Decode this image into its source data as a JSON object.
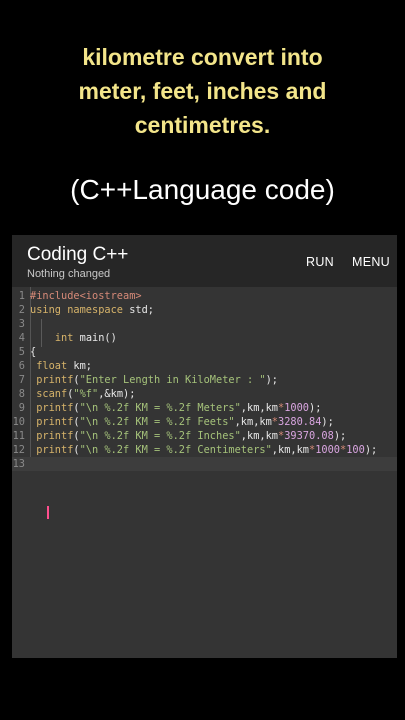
{
  "headline": {
    "lines": [
      "kilometre convert  into",
      "meter, feet, inches and",
      "centimetres."
    ]
  },
  "subheading": "(C++Language code)",
  "app": {
    "title": "Coding C++",
    "status": "Nothing changed",
    "run_label": "RUN",
    "menu_label": "MENU"
  },
  "editor": {
    "active_line": 13,
    "lines": [
      {
        "n": "1",
        "tokens": [
          [
            "op",
            "#include<iostream>"
          ]
        ]
      },
      {
        "n": "2",
        "tokens": [
          [
            "kw",
            "using namespace "
          ],
          [
            "plain",
            "std;"
          ]
        ]
      },
      {
        "n": "3",
        "tokens": []
      },
      {
        "n": "4",
        "tokens": [
          [
            "plain",
            "    "
          ],
          [
            "kw",
            "int "
          ],
          [
            "plain",
            "main()"
          ]
        ]
      },
      {
        "n": "5",
        "tokens": [
          [
            "plain",
            "{"
          ]
        ]
      },
      {
        "n": "6",
        "tokens": [
          [
            "plain",
            " "
          ],
          [
            "kw",
            "float "
          ],
          [
            "plain",
            "km;"
          ]
        ]
      },
      {
        "n": "7",
        "tokens": [
          [
            "kw",
            " printf"
          ],
          [
            "plain",
            "("
          ],
          [
            "str",
            "\"Enter Length in KiloMeter : \""
          ],
          [
            "plain",
            ");"
          ]
        ]
      },
      {
        "n": "8",
        "tokens": [
          [
            "kw",
            " scanf"
          ],
          [
            "plain",
            "("
          ],
          [
            "str",
            "\"%f\""
          ],
          [
            "plain",
            ",&km);"
          ]
        ]
      },
      {
        "n": "9",
        "tokens": [
          [
            "kw",
            " printf"
          ],
          [
            "plain",
            "("
          ],
          [
            "str",
            "\"\\n %.2f KM = %.2f Meters\""
          ],
          [
            "plain",
            ",km,km"
          ],
          [
            "op",
            "*"
          ],
          [
            "num",
            "1000"
          ],
          [
            "plain",
            ");"
          ]
        ]
      },
      {
        "n": "10",
        "tokens": [
          [
            "kw",
            " printf"
          ],
          [
            "plain",
            "("
          ],
          [
            "str",
            "\"\\n %.2f KM = %.2f Feets\""
          ],
          [
            "plain",
            ",km,km"
          ],
          [
            "op",
            "*"
          ],
          [
            "num",
            "3280.84"
          ],
          [
            "plain",
            ");"
          ]
        ]
      },
      {
        "n": "11",
        "tokens": [
          [
            "kw",
            " printf"
          ],
          [
            "plain",
            "("
          ],
          [
            "str",
            "\"\\n %.2f KM = %.2f Inches\""
          ],
          [
            "plain",
            ",km,km"
          ],
          [
            "op",
            "*"
          ],
          [
            "num",
            "39370.08"
          ],
          [
            "plain",
            ");"
          ]
        ]
      },
      {
        "n": "12",
        "tokens": [
          [
            "kw",
            " printf"
          ],
          [
            "plain",
            "("
          ],
          [
            "str",
            "\"\\n %.2f KM = %.2f Centimeters\""
          ],
          [
            "plain",
            ",km,km"
          ],
          [
            "op",
            "*"
          ],
          [
            "num",
            "1000"
          ],
          [
            "op",
            "*"
          ],
          [
            "num",
            "100"
          ],
          [
            "plain",
            ");"
          ]
        ]
      },
      {
        "n": "13",
        "tokens": []
      }
    ]
  }
}
